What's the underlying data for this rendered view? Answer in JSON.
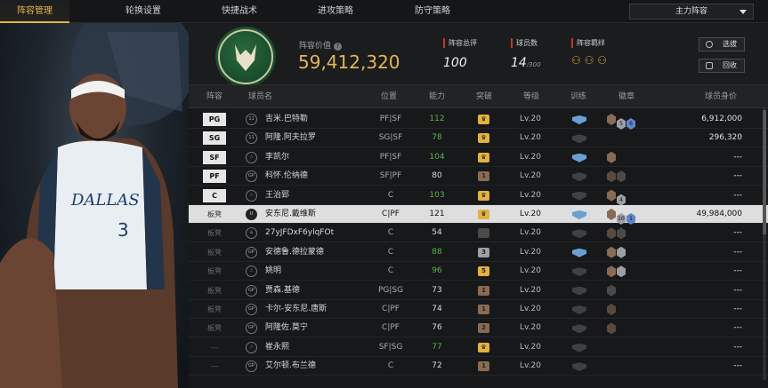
{
  "nav": {
    "tabs": [
      "阵容管理",
      "轮换设置",
      "快捷战术",
      "进攻策略",
      "防守策略"
    ],
    "lineup_select": "主力阵容"
  },
  "header": {
    "value_label": "阵容价值",
    "value": "59,412,320",
    "rating_label": "阵容总评",
    "rating": "100",
    "count_label": "球员数",
    "count": "14",
    "count_max": "/300",
    "bond_label": "阵容羁绊",
    "select_btn": "选拔",
    "recall_btn": "回收",
    "colors": {
      "accent": "#e0b34c",
      "red": "#c0392b",
      "team_green": "#1f5f37"
    }
  },
  "columns": [
    "阵容",
    "球员名",
    "位置",
    "能力",
    "突破",
    "等级",
    "训练",
    "徽章",
    "球员身价"
  ],
  "rows": [
    {
      "slot": "PG",
      "type": "starter",
      "icon": "11",
      "name": "吉米.巴特勒",
      "pos": "PF|SF",
      "ability": "112",
      "ability_color": "#5fb34b",
      "medal": "crown",
      "medal_color": "#e3b23c",
      "level": "Lv.20",
      "train": "blue",
      "badges": [
        "#8a6a52",
        "#9b9fa6",
        "#5d86c9"
      ],
      "badge_text": [
        "",
        "5",
        "6"
      ],
      "value": "6,912,000"
    },
    {
      "slot": "SG",
      "type": "starter",
      "icon": "11",
      "name": "阿隆.阿夫拉罗",
      "pos": "SG|SF",
      "ability": "78",
      "ability_color": "#5fb34b",
      "medal": "crown",
      "medal_color": "#e3b23c",
      "level": "Lv.20",
      "train": "grey",
      "badges": [],
      "badge_text": [],
      "value": "296,320"
    },
    {
      "slot": "SF",
      "type": "starter",
      "icon": "☆",
      "name": "李凯尔",
      "pos": "PF|SF",
      "ability": "104",
      "ability_color": "#5fb34b",
      "medal": "crown",
      "medal_color": "#e3b23c",
      "level": "Lv.20",
      "train": "blue",
      "badges": [
        "#8a6a52"
      ],
      "badge_text": [
        ""
      ],
      "value": "---"
    },
    {
      "slot": "PF",
      "type": "starter",
      "icon": "GP",
      "name": "科怀.伦纳德",
      "pos": "SF|PF",
      "ability": "80",
      "ability_color": "#dcdcdc",
      "medal": "1",
      "medal_color": "#8a6a52",
      "level": "Lv.20",
      "train": "grey",
      "badges": [
        "#5a4a3e",
        "#4a4a4a"
      ],
      "badge_text": [
        "",
        ""
      ],
      "value": "---"
    },
    {
      "slot": "C",
      "type": "starter",
      "icon": "☆",
      "name": "王治郅",
      "pos": "C",
      "ability": "103",
      "ability_color": "#5fb34b",
      "medal": "crown",
      "medal_color": "#e3b23c",
      "level": "Lv.20",
      "train": "grey",
      "badges": [
        "#8a6a52",
        "#9b9fa6"
      ],
      "badge_text": [
        "",
        "4"
      ],
      "value": "---"
    },
    {
      "slot": "板凳",
      "type": "bench",
      "icon": "II",
      "name": "安东尼.戴维斯",
      "pos": "C|PF",
      "ability": "121",
      "ability_color": "#111",
      "medal": "crown",
      "medal_color": "#e3b23c",
      "level": "Lv.20",
      "train": "blue",
      "badges": [
        "#8a6a52",
        "#9b9fa6",
        "#5d86c9"
      ],
      "badge_text": [
        "",
        "10",
        "1"
      ],
      "value": "49,984,000",
      "selected": true
    },
    {
      "slot": "板凳",
      "type": "bench",
      "icon": "♙",
      "name": "27yJFDxF6ylqFOt",
      "pos": "C",
      "ability": "54",
      "ability_color": "#dcdcdc",
      "medal": "-",
      "medal_color": "#4a4a4a",
      "level": "Lv.20",
      "train": "grey",
      "badges": [
        "#5a4a3e",
        "#4a4a4a"
      ],
      "badge_text": [
        "",
        ""
      ],
      "value": "---"
    },
    {
      "slot": "板凳",
      "type": "bench",
      "icon": "GP",
      "name": "安德鲁.德拉蒙德",
      "pos": "C",
      "ability": "88",
      "ability_color": "#5fb34b",
      "medal": "3",
      "medal_color": "#9b9fa6",
      "level": "Lv.20",
      "train": "blue",
      "badges": [
        "#8a6a52",
        "#9b9fa6"
      ],
      "badge_text": [
        "",
        ""
      ],
      "value": "---"
    },
    {
      "slot": "板凳",
      "type": "bench",
      "icon": "☆",
      "name": "姚明",
      "pos": "C",
      "ability": "96",
      "ability_color": "#5fb34b",
      "medal": "5",
      "medal_color": "#e3b23c",
      "level": "Lv.20",
      "train": "grey",
      "badges": [
        "#8a6a52",
        "#9b9fa6"
      ],
      "badge_text": [
        "",
        ""
      ],
      "value": "---"
    },
    {
      "slot": "板凳",
      "type": "bench",
      "icon": "GP",
      "name": "贾森.基德",
      "pos": "PG|SG",
      "ability": "73",
      "ability_color": "#dcdcdc",
      "medal": "1",
      "medal_color": "#8a6a52",
      "level": "Lv.20",
      "train": "grey",
      "badges": [
        "#4a4a4a"
      ],
      "badge_text": [
        ""
      ],
      "value": "---"
    },
    {
      "slot": "板凳",
      "type": "bench",
      "icon": "GP",
      "name": "卡尔-安东尼.唐斯",
      "pos": "C|PF",
      "ability": "74",
      "ability_color": "#dcdcdc",
      "medal": "1",
      "medal_color": "#8a6a52",
      "level": "Lv.20",
      "train": "grey",
      "badges": [
        "#5a4a3e"
      ],
      "badge_text": [
        ""
      ],
      "value": "---"
    },
    {
      "slot": "板凳",
      "type": "bench",
      "icon": "GP",
      "name": "阿隆佐.莫宁",
      "pos": "C|PF",
      "ability": "76",
      "ability_color": "#dcdcdc",
      "medal": "2",
      "medal_color": "#8a6a52",
      "level": "Lv.20",
      "train": "grey",
      "badges": [
        "#5a4a3e"
      ],
      "badge_text": [
        ""
      ],
      "value": "---"
    },
    {
      "slot": "---",
      "type": "bench",
      "icon": "☆",
      "name": "崔永熙",
      "pos": "SF|SG",
      "ability": "77",
      "ability_color": "#5fb34b",
      "medal": "crown",
      "medal_color": "#e3b23c",
      "level": "Lv.20",
      "train": "grey",
      "badges": [],
      "badge_text": [],
      "value": "---"
    },
    {
      "slot": "---",
      "type": "bench",
      "icon": "GP",
      "name": "艾尔顿.布兰德",
      "pos": "C",
      "ability": "72",
      "ability_color": "#dcdcdc",
      "medal": "1",
      "medal_color": "#8a6a52",
      "level": "Lv.20",
      "train": "grey",
      "badges": [],
      "badge_text": [],
      "value": "---"
    }
  ]
}
